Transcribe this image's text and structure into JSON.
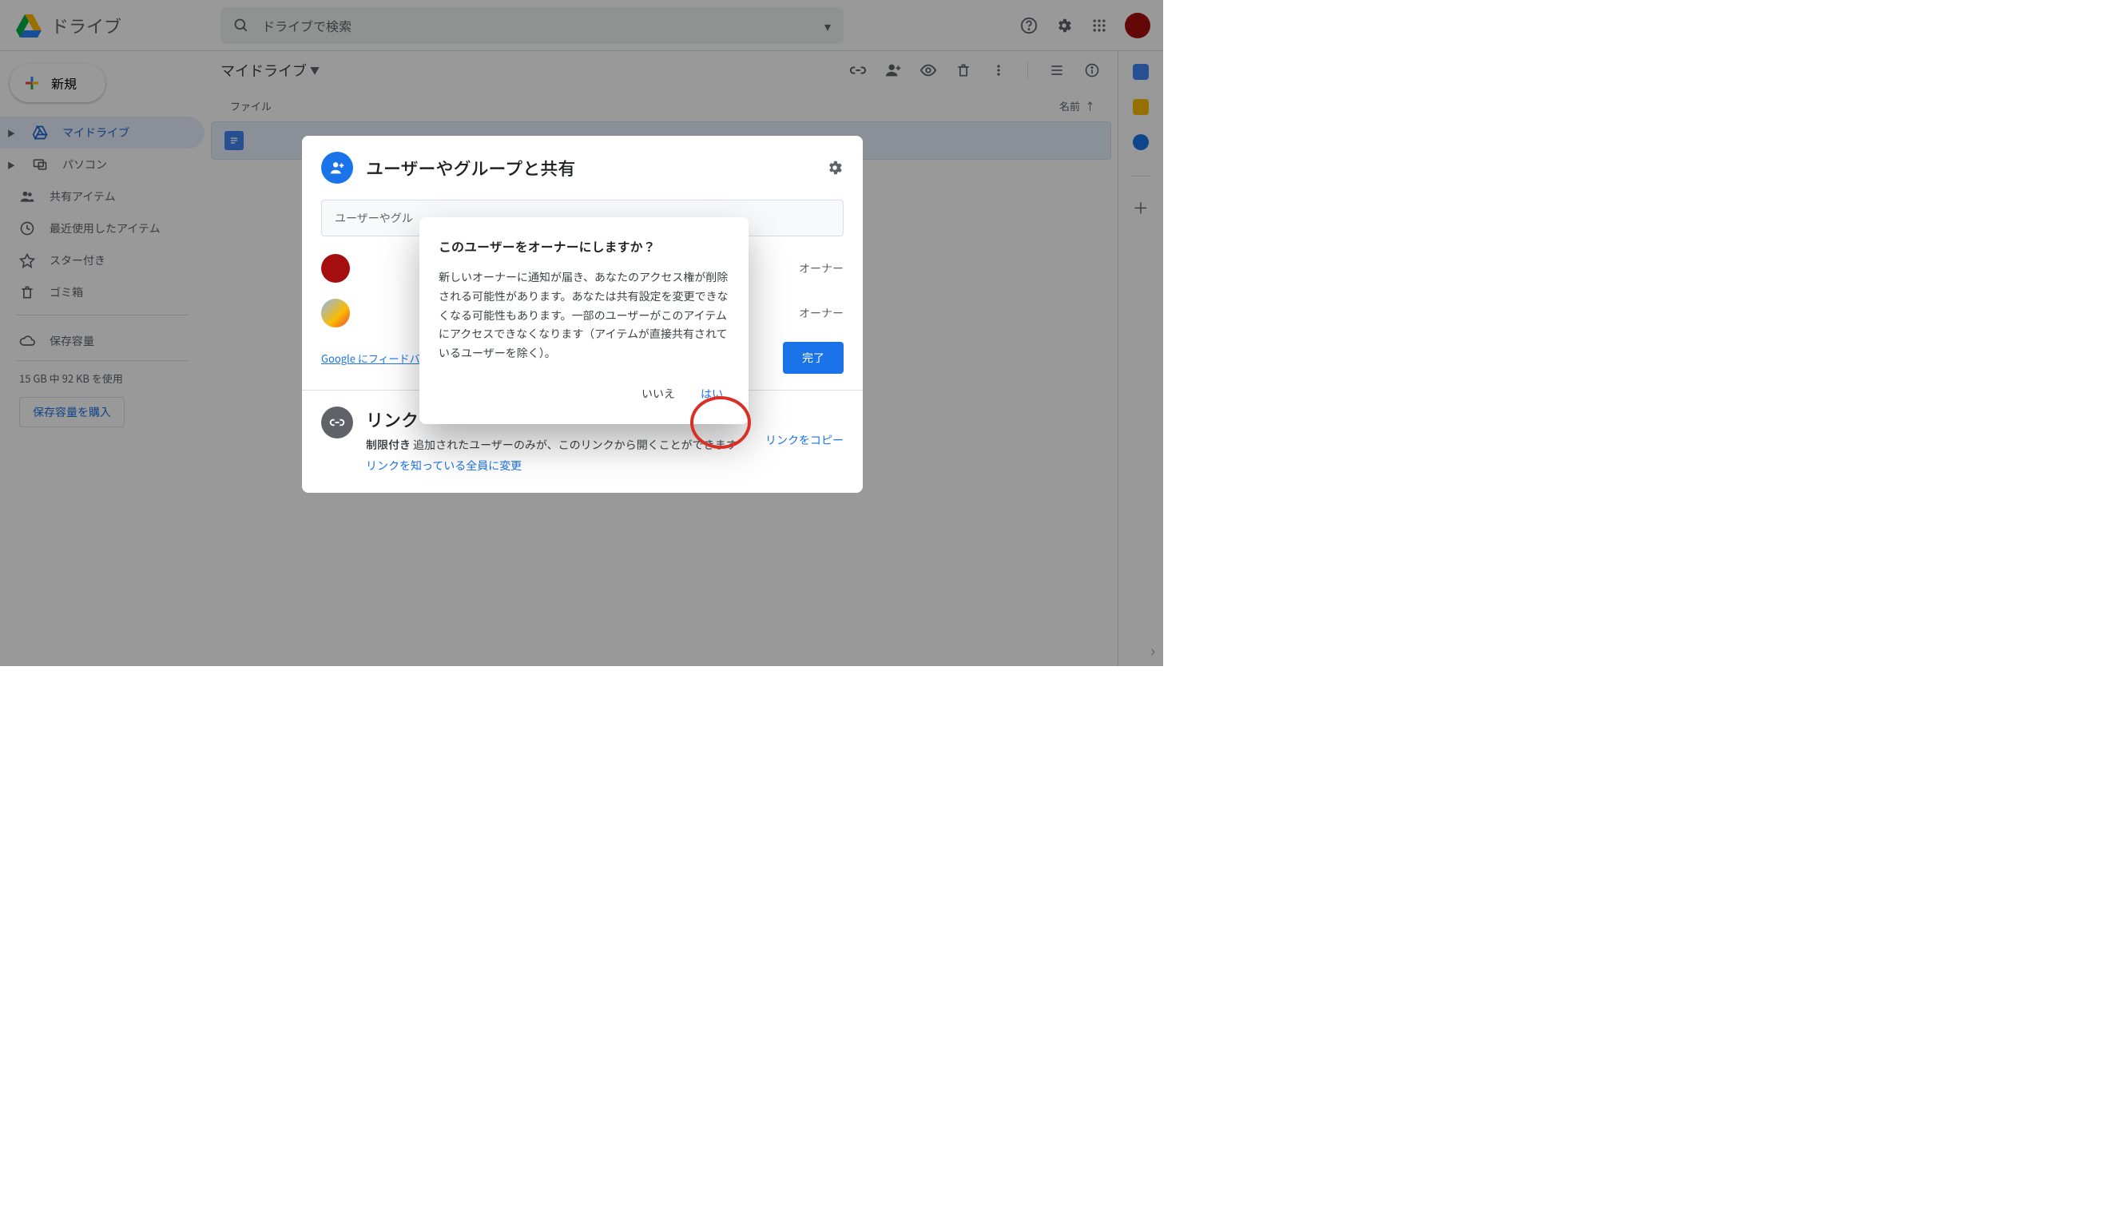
{
  "header": {
    "app_title": "ドライブ",
    "search_placeholder": "ドライブで検索"
  },
  "sidebar": {
    "new_label": "新規",
    "items": [
      {
        "label": "マイドライブ"
      },
      {
        "label": "パソコン"
      },
      {
        "label": "共有アイテム"
      },
      {
        "label": "最近使用したアイテム"
      },
      {
        "label": "スター付き"
      },
      {
        "label": "ゴミ箱"
      },
      {
        "label": "保存容量"
      }
    ],
    "storage_usage": "15 GB 中 92 KB を使用",
    "buy_storage": "保存容量を購入"
  },
  "main": {
    "breadcrumb": "マイドライブ",
    "list_header_file": "ファイル",
    "list_header_name": "名前"
  },
  "share": {
    "title": "ユーザーやグループと共有",
    "input_placeholder": "ユーザーやグル",
    "people": [
      {
        "role": "オーナー"
      },
      {
        "role": "オーナー"
      }
    ],
    "feedback": "Google にフィードバ",
    "done": "完了",
    "link_title": "リンク",
    "link_restricted": "制限付き",
    "link_desc": "追加されたユーザーのみが、このリンクから開くことができます",
    "link_change": "リンクを知っている全員に変更",
    "copy_link": "リンクをコピー"
  },
  "confirm": {
    "title": "このユーザーをオーナーにしますか？",
    "body": "新しいオーナーに通知が届き、あなたのアクセス権が削除される可能性があります。あなたは共有設定を変更できなくなる可能性もあります。一部のユーザーがこのアイテムにアクセスできなくなります（アイテムが直接共有されているユーザーを除く）。",
    "no": "いいえ",
    "yes": "はい"
  }
}
